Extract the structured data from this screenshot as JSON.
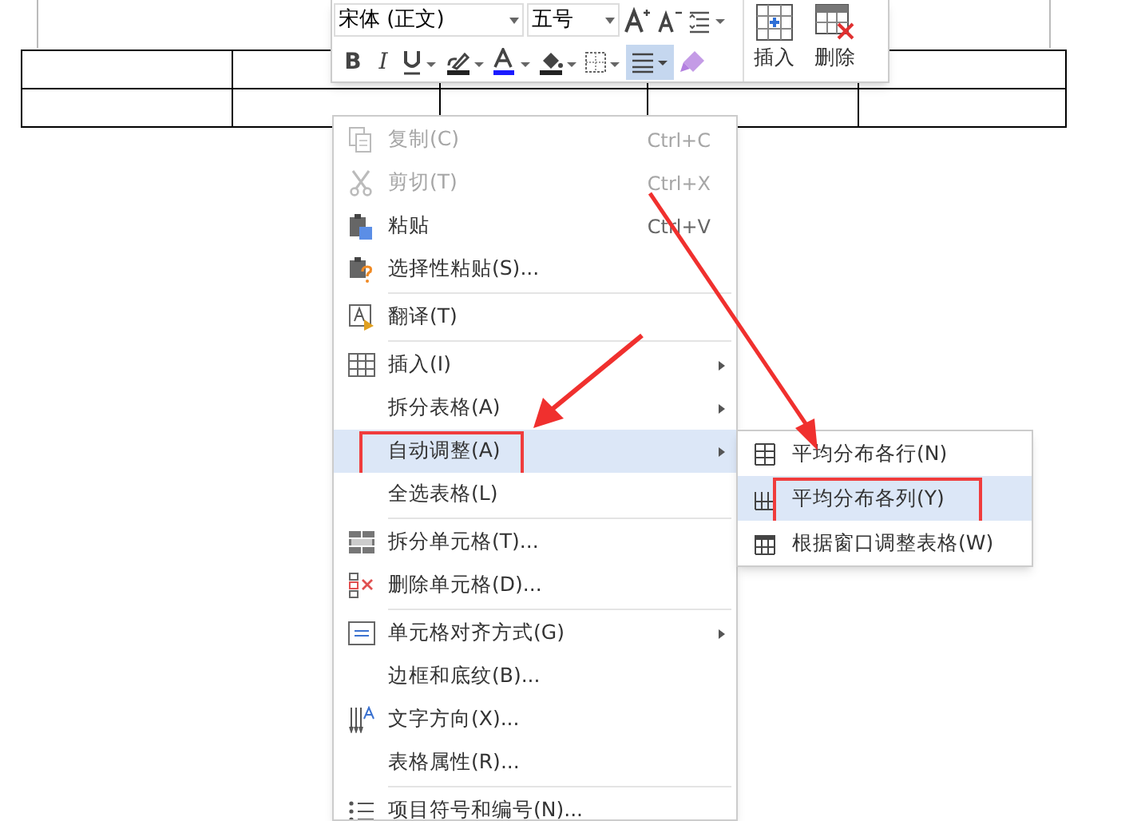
{
  "toolbar": {
    "font": "宋体 (正文)",
    "size": "五号",
    "bold": "B",
    "italic": "I",
    "align_selected": true,
    "big_buttons": [
      {
        "label": "插入"
      },
      {
        "label": "删除"
      }
    ]
  },
  "context_menu": [
    {
      "kind": "item",
      "label": "复制(C)",
      "shortcut": "Ctrl+C",
      "disabled": true,
      "submenu": false,
      "selected": false,
      "annotated": false
    },
    {
      "kind": "item",
      "label": "剪切(T)",
      "shortcut": "Ctrl+X",
      "disabled": true,
      "submenu": false,
      "selected": false,
      "annotated": false
    },
    {
      "kind": "item",
      "label": "粘贴",
      "shortcut": "Ctrl+V",
      "disabled": false,
      "submenu": false,
      "selected": false,
      "annotated": false
    },
    {
      "kind": "item",
      "label": "选择性粘贴(S)...",
      "disabled": false,
      "submenu": false,
      "selected": false,
      "annotated": false
    },
    {
      "kind": "separator"
    },
    {
      "kind": "item",
      "label": "翻译(T)",
      "disabled": false,
      "submenu": false,
      "selected": false,
      "annotated": false
    },
    {
      "kind": "separator"
    },
    {
      "kind": "item",
      "label": "插入(I)",
      "disabled": false,
      "submenu": true,
      "selected": false,
      "annotated": false
    },
    {
      "kind": "item",
      "label": "拆分表格(A)",
      "disabled": false,
      "submenu": true,
      "selected": false,
      "annotated": false
    },
    {
      "kind": "item",
      "label": "自动调整(A)",
      "disabled": false,
      "submenu": true,
      "selected": true,
      "annotated": true
    },
    {
      "kind": "item",
      "label": "全选表格(L)",
      "disabled": false,
      "submenu": false,
      "selected": false,
      "annotated": false
    },
    {
      "kind": "separator"
    },
    {
      "kind": "item",
      "label": "拆分单元格(T)...",
      "disabled": false,
      "submenu": false,
      "selected": false,
      "annotated": false
    },
    {
      "kind": "item",
      "label": "删除单元格(D)...",
      "disabled": false,
      "submenu": false,
      "selected": false,
      "annotated": false
    },
    {
      "kind": "separator"
    },
    {
      "kind": "item",
      "label": "单元格对齐方式(G)",
      "disabled": false,
      "submenu": true,
      "selected": false,
      "annotated": false
    },
    {
      "kind": "item",
      "label": "边框和底纹(B)...",
      "disabled": false,
      "submenu": false,
      "selected": false,
      "annotated": false
    },
    {
      "kind": "item",
      "label": "文字方向(X)...",
      "disabled": false,
      "submenu": false,
      "selected": false,
      "annotated": false
    },
    {
      "kind": "item",
      "label": "表格属性(R)...",
      "disabled": false,
      "submenu": false,
      "selected": false,
      "annotated": false
    },
    {
      "kind": "separator"
    },
    {
      "kind": "item",
      "label": "项目符号和编号(N)...",
      "disabled": false,
      "submenu": false,
      "selected": false,
      "annotated": false
    }
  ],
  "submenu": [
    {
      "label": "平均分布各行(N)",
      "selected": false,
      "annotated": false
    },
    {
      "label": "平均分布各列(Y)",
      "selected": true,
      "annotated": true
    },
    {
      "label": "根据窗口调整表格(W)",
      "selected": false,
      "annotated": false
    }
  ]
}
